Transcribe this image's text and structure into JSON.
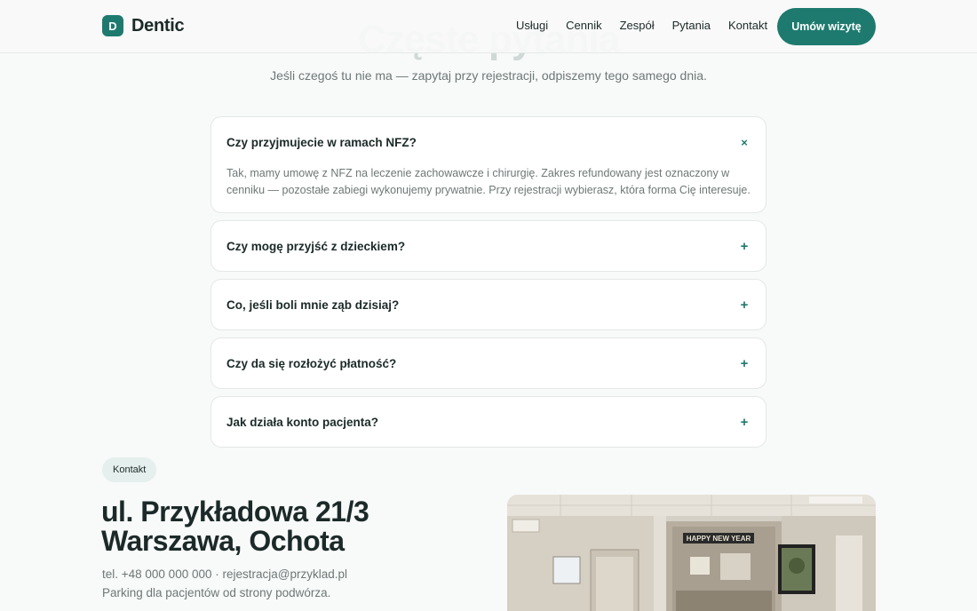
{
  "header": {
    "logo_letter": "D",
    "brand": "Dentic",
    "nav": [
      "Usługi",
      "Cennik",
      "Zespół",
      "Pytania",
      "Kontakt"
    ],
    "cta": "Umów wizytę"
  },
  "faq": {
    "heading": "Częste pytania",
    "subtitle": "Jeśli czegoś tu nie ma — zapytaj przy rejestracji, odpiszemy tego samego dnia.",
    "items": [
      {
        "question": "Czy przyjmujecie w ramach NFZ?",
        "answer": "Tak, mamy umowę z NFZ na leczenie zachowawcze i chirurgię. Zakres refundowany jest oznaczony w cenniku — pozostałe zabiegi wykonujemy prywatnie. Przy rejestracji wybierasz, która forma Cię interesuje.",
        "icon": "×"
      },
      {
        "question": "Czy mogę przyjść z dzieckiem?",
        "icon": "+"
      },
      {
        "question": "Co, jeśli boli mnie ząb dzisiaj?",
        "icon": "+"
      },
      {
        "question": "Czy da się rozłożyć płatność?",
        "icon": "+"
      },
      {
        "question": "Jak działa konto pacjenta?",
        "icon": "+"
      }
    ]
  },
  "contact": {
    "badge": "Kontakt",
    "address_line1": "ul. Przykładowa 21/3",
    "address_line2": "Warszawa, Ochota",
    "phone_email": "tel. +48 000 000 000 · rejestracja@przyklad.pl",
    "parking": "Parking dla pacjentów od strony podwórza.",
    "photo_banner": "HAPPY NEW YEAR"
  },
  "colors": {
    "accent": "#1e7a6e",
    "text": "#1b2a28",
    "muted": "#6d7876",
    "background": "#f8f9f9"
  }
}
